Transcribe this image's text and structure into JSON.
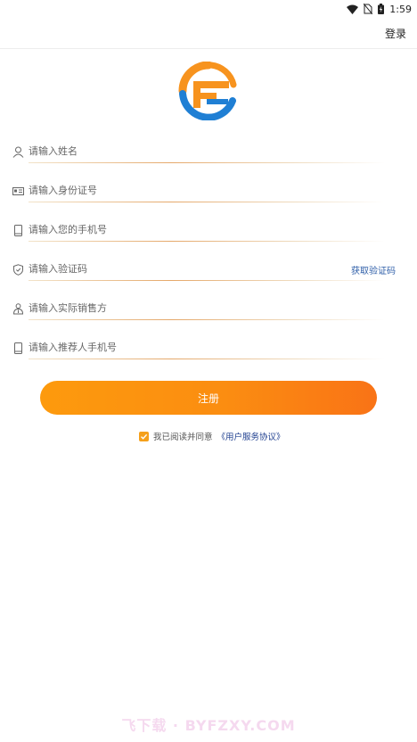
{
  "status_bar": {
    "time": "1:59"
  },
  "header": {
    "login_label": "登录"
  },
  "form": {
    "name_placeholder": "请输入姓名",
    "id_placeholder": "请输入身份证号",
    "phone_placeholder": "请输入您的手机号",
    "code_placeholder": "请输入验证码",
    "get_code_label": "获取验证码",
    "seller_placeholder": "请输入实际销售方",
    "referrer_placeholder": "请输入推荐人手机号"
  },
  "register_label": "注册",
  "agreement": {
    "checked": true,
    "prefix": "我已阅读并同意",
    "link": "《用户服务协议》"
  },
  "watermark": "飞下载 · BYFZXY.COM",
  "colors": {
    "accent": "#fb8d11",
    "link": "#1f3f8f"
  }
}
